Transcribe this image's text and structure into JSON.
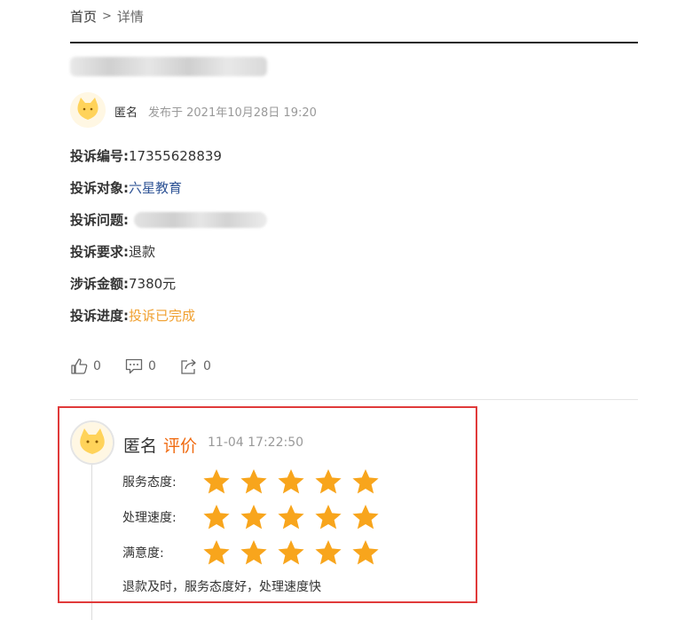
{
  "breadcrumb": {
    "home": "首页",
    "separator": ">",
    "current": "详情"
  },
  "post": {
    "author": "匿名",
    "posted_label": "发布于 2021年10月28日 19:20"
  },
  "details": [
    {
      "label": "投诉编号:",
      "value": "17355628839",
      "style": "plain"
    },
    {
      "label": "投诉对象:",
      "value": "六星教育",
      "style": "link"
    },
    {
      "label": "投诉问题:",
      "value": "",
      "style": "blurred"
    },
    {
      "label": "投诉要求:",
      "value": "退款",
      "style": "plain"
    },
    {
      "label": "涉诉金额:",
      "value": "7380元",
      "style": "plain"
    },
    {
      "label": "投诉进度:",
      "value": "投诉已完成",
      "style": "orange"
    }
  ],
  "actions": {
    "like_count": "0",
    "comment_count": "0",
    "share_count": "0"
  },
  "review": {
    "author": "匿名",
    "tag": "评价",
    "time": "11-04 17:22:50",
    "ratings": [
      {
        "label": "服务态度:",
        "stars": 5
      },
      {
        "label": "处理速度:",
        "stars": 5
      },
      {
        "label": "满意度:",
        "stars": 5
      }
    ],
    "comment": "退款及时，服务态度好，处理速度快"
  },
  "colors": {
    "accent_orange": "#f0a030",
    "tag_orange": "#f06a10",
    "link_blue": "#2f5496",
    "highlight_red": "#e03a3a",
    "star": "#f8a51c"
  },
  "icons": [
    "cat-avatar-icon",
    "thumbs-up-icon",
    "comment-icon",
    "share-icon",
    "star-icon"
  ]
}
